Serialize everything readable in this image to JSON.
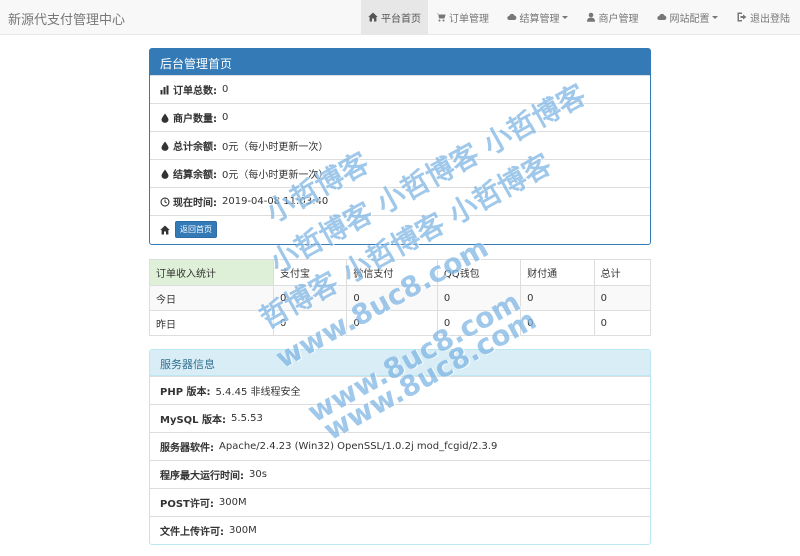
{
  "brand": "新源代支付管理中心",
  "nav": [
    {
      "label": "平台首页",
      "icon": "home-icon",
      "active": true
    },
    {
      "label": "订单管理",
      "icon": "cart-icon"
    },
    {
      "label": "结算管理",
      "icon": "cloud-icon",
      "dropdown": true
    },
    {
      "label": "商户管理",
      "icon": "user-icon"
    },
    {
      "label": "网站配置",
      "icon": "cloud-icon",
      "dropdown": true
    },
    {
      "label": "退出登陆",
      "icon": "logout-icon"
    }
  ],
  "admin_panel": {
    "title": "后台管理首页",
    "rows": [
      {
        "label": "订单总数:",
        "value": "0",
        "icon": "stats-icon"
      },
      {
        "label": "商户数量:",
        "value": "0",
        "icon": "drop-icon"
      },
      {
        "label": "总计余额:",
        "value": "0元（每小时更新一次）",
        "icon": "drop-icon"
      },
      {
        "label": "结算余额:",
        "value": "0元（每小时更新一次）",
        "icon": "drop-icon"
      },
      {
        "label": "现在时间:",
        "value": "2019-04-08 11:03:40",
        "icon": "clock-icon"
      }
    ],
    "back_button": "返回首页"
  },
  "stats_table": {
    "headers": [
      "订单收入统计",
      "支付宝",
      "微信支付",
      "QQ钱包",
      "财付通",
      "总计"
    ],
    "rows": [
      [
        "今日",
        "0",
        "0",
        "0",
        "0",
        "0"
      ],
      [
        "昨日",
        "0",
        "0",
        "0",
        "0",
        "0"
      ]
    ]
  },
  "server_panel": {
    "title": "服务器信息",
    "rows": [
      {
        "label": "PHP 版本:",
        "value": "5.4.45 非线程安全"
      },
      {
        "label": "MySQL 版本:",
        "value": "5.5.53"
      },
      {
        "label": "服务器软件:",
        "value": "Apache/2.4.23 (Win32) OpenSSL/1.0.2j mod_fcgid/2.3.9"
      },
      {
        "label": "程序最大运行时间:",
        "value": "30s"
      },
      {
        "label": "POST许可:",
        "value": "300M"
      },
      {
        "label": "文件上传许可:",
        "value": "300M"
      }
    ]
  },
  "watermark": {
    "line1": "小哲博客",
    "line2": "小哲博客 小哲博客 小哲博客",
    "line3": "哲博客 小哲博客 小哲博客",
    "line4": "www.8uc8.com",
    "line5": "www.8uc8.com",
    "line6": "www.8uc8.com"
  }
}
